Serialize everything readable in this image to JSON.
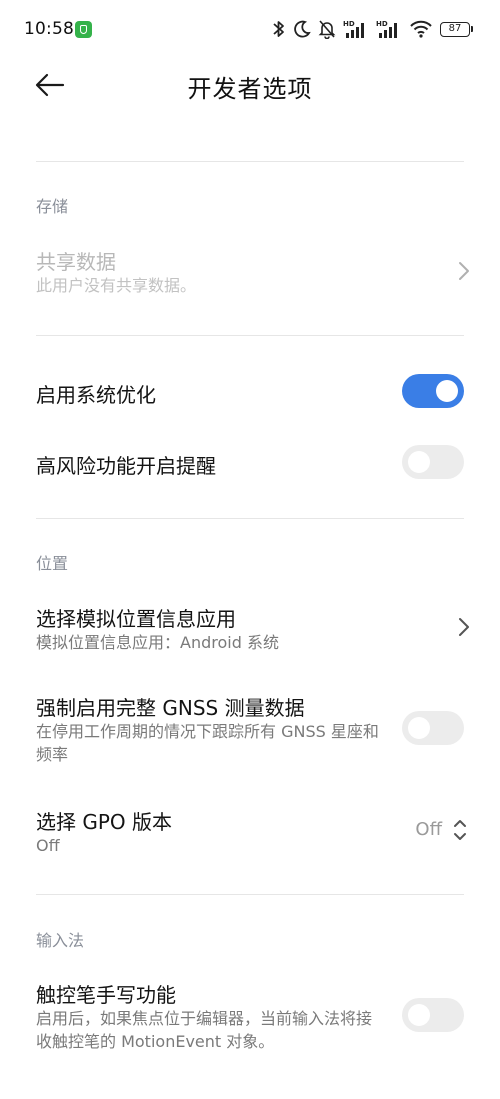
{
  "status_bar": {
    "time": "10:58",
    "battery": "87",
    "icons": [
      "bluetooth-icon",
      "moon-icon",
      "bell-muted-icon",
      "hd-signal-icon",
      "hd-signal-icon",
      "wifi-icon",
      "battery-icon"
    ]
  },
  "header": {
    "title": "开发者选项",
    "back_icon": "arrow-left-icon"
  },
  "sections": {
    "storage": {
      "title": "存储",
      "shared_data": {
        "title": "共享数据",
        "subtitle": "此用户没有共享数据。"
      }
    },
    "system": {
      "enable_optimization": {
        "title": "启用系统优化",
        "on": true
      },
      "high_risk_reminder": {
        "title": "高风险功能开启提醒",
        "on": false
      }
    },
    "location": {
      "title": "位置",
      "mock_location_app": {
        "title": "选择模拟位置信息应用",
        "subtitle": "模拟位置信息应用：Android 系统"
      },
      "full_gnss": {
        "title": "强制启用完整 GNSS 测量数据",
        "subtitle": "在停用工作周期的情况下跟踪所有 GNSS 星座和频率",
        "on": false
      },
      "gpo_version": {
        "title": "选择 GPO 版本",
        "subtitle": "Off",
        "value": "Off"
      }
    },
    "input_method": {
      "title": "输入法",
      "stylus_handwriting": {
        "title": "触控笔手写功能",
        "subtitle": "启用后，如果焦点位于编辑器，当前输入法将接收触控笔的 MotionEvent 对象。",
        "on": false
      }
    }
  },
  "colors": {
    "accent": "#3a7ee6",
    "switch_off": "#ececec",
    "section_title": "#8a8f99"
  }
}
